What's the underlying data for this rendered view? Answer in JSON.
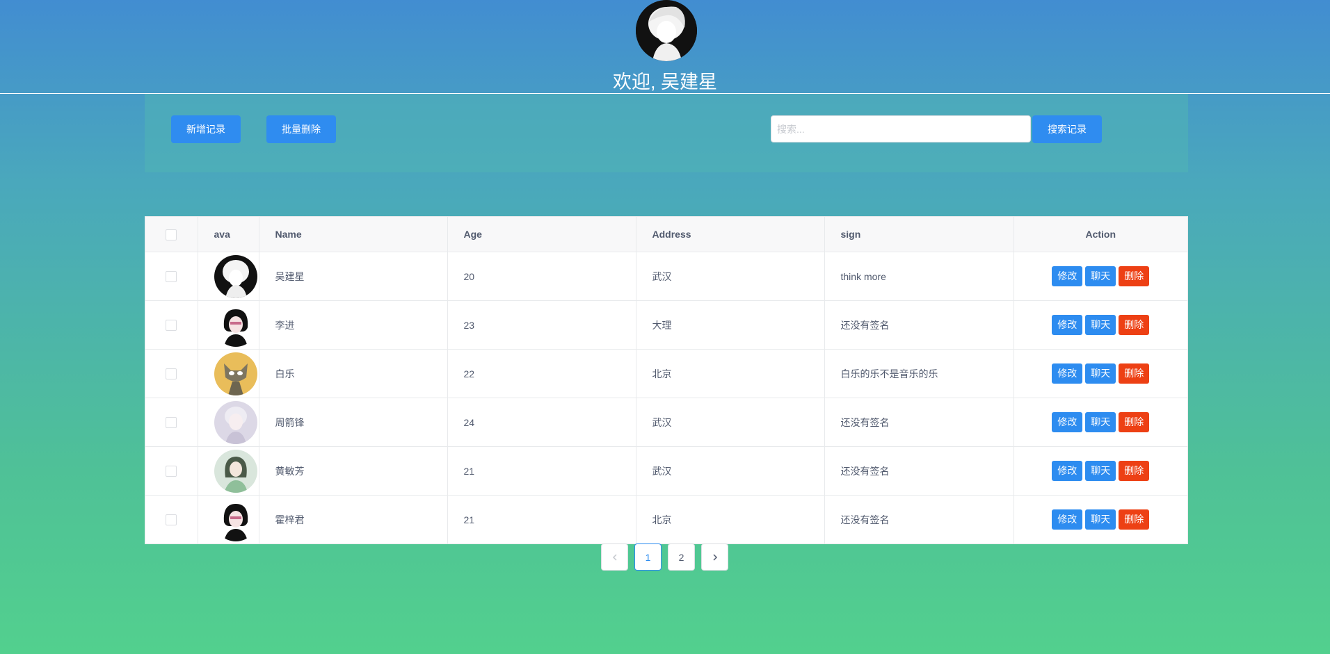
{
  "header": {
    "welcome_text": "欢迎, 吴建星",
    "avatar_icon": "user-avatar"
  },
  "toolbar": {
    "add_label": "新增记录",
    "batch_delete_label": "批量删除",
    "search_placeholder": "搜索...",
    "search_value": "",
    "search_button_label": "搜索记录"
  },
  "table": {
    "columns": [
      "",
      "ava",
      "Name",
      "Age",
      "Address",
      "sign",
      "Action"
    ],
    "rows": [
      {
        "name": "吴建星",
        "age": "20",
        "address": "武汉",
        "sign": "think more",
        "avatar": "white-hair-sketch-avatar"
      },
      {
        "name": "李进",
        "age": "23",
        "address": "大理",
        "sign": "还没有签名",
        "avatar": "black-hair-girl-avatar"
      },
      {
        "name": "白乐",
        "age": "22",
        "address": "北京",
        "sign": "白乐的乐不是音乐的乐",
        "avatar": "cartoon-cat-avatar"
      },
      {
        "name": "周箭锋",
        "age": "24",
        "address": "武汉",
        "sign": "还没有签名",
        "avatar": "pale-anime-avatar"
      },
      {
        "name": "黄敏芳",
        "age": "21",
        "address": "武汉",
        "sign": "还没有签名",
        "avatar": "anime-girl-avatar"
      },
      {
        "name": "霍梓君",
        "age": "21",
        "address": "北京",
        "sign": "还没有签名",
        "avatar": "black-hair-girl-avatar"
      }
    ],
    "actions": {
      "edit": "修改",
      "chat": "聊天",
      "delete": "删除"
    }
  },
  "pagination": {
    "prev_icon": "chevron-left-icon",
    "pages": [
      "1",
      "2"
    ],
    "current": "1",
    "next_icon": "chevron-right-icon"
  },
  "colors": {
    "primary": "#2d8cf0",
    "danger": "#ed4014",
    "bg_top": "#428dd1",
    "bg_bottom": "#52d08e"
  }
}
